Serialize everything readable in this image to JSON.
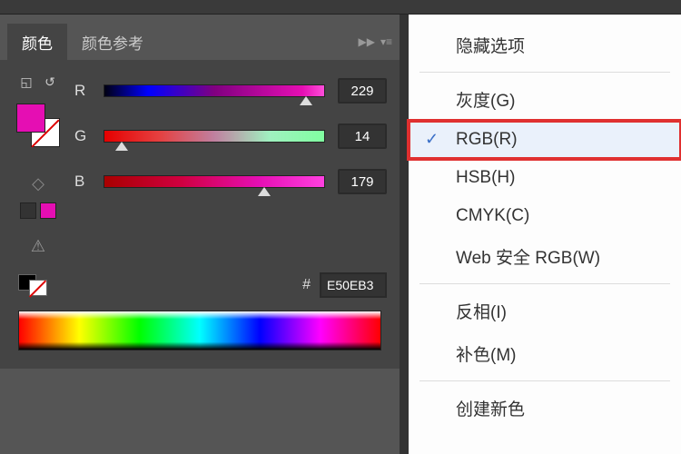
{
  "tabs": {
    "color": "颜色",
    "color_guide": "颜色参考"
  },
  "sliders": {
    "r": {
      "label": "R",
      "value": "229",
      "pos": 89
    },
    "g": {
      "label": "G",
      "value": "14",
      "pos": 5
    },
    "b": {
      "label": "B",
      "value": "179",
      "pos": 70
    }
  },
  "hex": {
    "hash": "#",
    "value": "E50EB3"
  },
  "colors": {
    "current": "#e50eb3"
  },
  "menu": {
    "hide_options": "隐藏选项",
    "grayscale": "灰度(G)",
    "rgb": "RGB(R)",
    "hsb": "HSB(H)",
    "cmyk": "CMYK(C)",
    "web_safe": "Web 安全 RGB(W)",
    "invert": "反相(I)",
    "complement": "补色(M)",
    "create_new": "创建新色"
  }
}
